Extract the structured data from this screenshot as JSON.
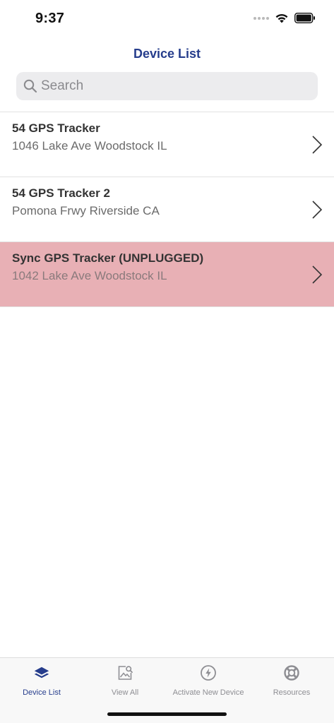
{
  "status_bar": {
    "time": "9:37"
  },
  "header": {
    "title": "Device List"
  },
  "search": {
    "placeholder": "Search"
  },
  "devices": [
    {
      "name": "54 GPS Tracker",
      "address": "1046 Lake Ave Woodstock IL",
      "alert": false
    },
    {
      "name": "54 GPS Tracker 2",
      "address": "Pomona Frwy Riverside CA",
      "alert": false
    },
    {
      "name": "Sync GPS Tracker (UNPLUGGED)",
      "address": "1042 Lake Ave Woodstock IL",
      "alert": true
    }
  ],
  "tab_bar": {
    "tabs": [
      {
        "label": "Device List",
        "icon": "layers-icon",
        "active": true
      },
      {
        "label": "View All",
        "icon": "image-search-icon",
        "active": false
      },
      {
        "label": "Activate New Device",
        "icon": "lightning-icon",
        "active": false
      },
      {
        "label": "Resources",
        "icon": "lifebuoy-icon",
        "active": false
      }
    ]
  },
  "colors": {
    "accent": "#263d8c",
    "alert_row": "#e8b0b5",
    "search_bg": "#ececee",
    "inactive_tab": "#8e8e93"
  }
}
